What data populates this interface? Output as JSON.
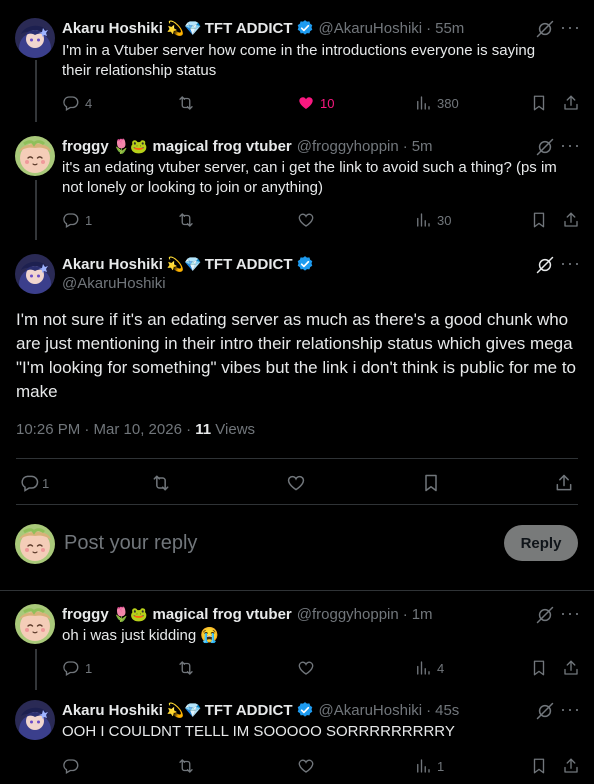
{
  "tweets": [
    {
      "name": "Akaru Hoshiki",
      "emoji": "💫💎",
      "tag": "TFT ADDICT",
      "handle": "@AkaruHoshiki",
      "time": "55m",
      "text": "I'm in a Vtuber server how come in the introductions everyone is saying their relationship status",
      "replies": "4",
      "reposts": "",
      "likes": "10",
      "views": "380"
    },
    {
      "name": "froggy",
      "emoji": "🌷🐸",
      "tag": "magical frog vtuber",
      "handle": "@froggyhoppin",
      "time": "5m",
      "text": "it's an edating vtuber server, can i get the link to avoid such a thing? (ps im not lonely or looking to join or anything)",
      "replies": "1",
      "reposts": "",
      "likes": "",
      "views": "30"
    }
  ],
  "main": {
    "name": "Akaru Hoshiki",
    "emoji": "💫💎",
    "tag": "TFT ADDICT",
    "handle": "@AkaruHoshiki",
    "text": "I'm not sure if it's an edating server as much as there's a good chunk who are just mentioning in their intro their relationship status which gives mega \"I'm looking for something\" vibes but the link i don't think is public for me to make",
    "timestamp": "10:26 PM · Mar 10, 2026 · ",
    "views_count": "11",
    "views_label": " Views",
    "replies": "1"
  },
  "reply_box": {
    "placeholder": "Post your reply",
    "button": "Reply"
  },
  "replies": [
    {
      "name": "froggy",
      "emoji": "🌷🐸",
      "tag": "magical frog vtuber",
      "handle": "@froggyhoppin",
      "time": "1m",
      "text": "oh i was just kidding 😭",
      "replies": "1",
      "views": "4"
    },
    {
      "name": "Akaru Hoshiki",
      "emoji": "💫💎",
      "tag": "TFT ADDICT",
      "handle": "@AkaruHoshiki",
      "time": "45s",
      "text": "OOH I COULDNT TELLL IM SOOOOO SORRRRRRRRRY",
      "replies": "",
      "views": "1"
    }
  ],
  "colors": {
    "background": "#000000",
    "text": "#e7e9ea",
    "muted": "#71767b",
    "like_active": "#f91880",
    "verified": "#1d9bf0",
    "divider": "#2f3336"
  },
  "icons": [
    "reply-icon",
    "repost-icon",
    "like-icon",
    "views-icon",
    "bookmark-icon",
    "share-icon",
    "grok-icon",
    "more-icon",
    "verified-icon"
  ]
}
